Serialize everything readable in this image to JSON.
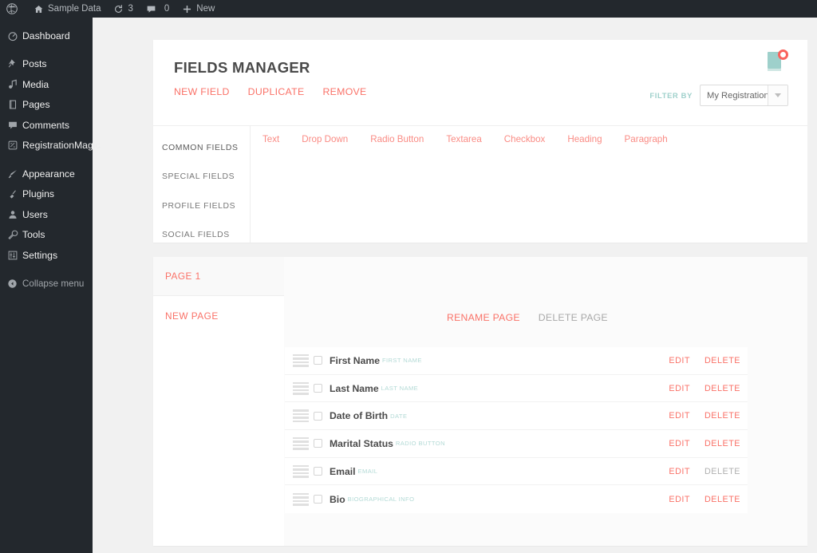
{
  "adminbar": {
    "logo_icon": "wordpress-logo-icon",
    "site_icon": "home-icon",
    "site_name": "Sample Data",
    "updates_icon": "updates-icon",
    "updates_count": "3",
    "comments_icon": "comment-bubble-icon",
    "comments_count": "0",
    "new_icon": "plus-icon",
    "new_label": "New"
  },
  "sidebar": {
    "items": [
      {
        "label": "Dashboard",
        "icon": "dashboard-icon"
      },
      {
        "label": "Posts",
        "icon": "pin-icon"
      },
      {
        "label": "Media",
        "icon": "media-icon"
      },
      {
        "label": "Pages",
        "icon": "pages-icon"
      },
      {
        "label": "Comments",
        "icon": "comment-bubble-icon"
      },
      {
        "label": "RegistrationMagic",
        "icon": "registrationmagic-icon"
      },
      {
        "label": "Appearance",
        "icon": "paintbrush-icon"
      },
      {
        "label": "Plugins",
        "icon": "plug-icon"
      },
      {
        "label": "Users",
        "icon": "user-icon"
      },
      {
        "label": "Tools",
        "icon": "wrench-icon"
      },
      {
        "label": "Settings",
        "icon": "sliders-icon"
      }
    ],
    "collapse_label": "Collapse menu",
    "collapse_icon": "collapse-arrow-icon"
  },
  "fields_manager": {
    "title": "FIELDS MANAGER",
    "actions": [
      {
        "label": "NEW FIELD",
        "state": "active"
      },
      {
        "label": "DUPLICATE",
        "state": "active"
      },
      {
        "label": "REMOVE",
        "state": "active"
      }
    ],
    "sticky_icon": "sticky-note-badge-icon",
    "filter": {
      "label": "FILTER BY",
      "value": "My Registration F...",
      "caret_icon": "chevron-down-icon"
    },
    "categories": [
      {
        "label": "COMMON FIELDS",
        "active": true
      },
      {
        "label": "SPECIAL FIELDS",
        "active": false
      },
      {
        "label": "PROFILE FIELDS",
        "active": false
      },
      {
        "label": "SOCIAL FIELDS",
        "active": false
      }
    ],
    "field_types": [
      "Text",
      "Drop Down",
      "Radio Button",
      "Textarea",
      "Checkbox",
      "Heading",
      "Paragraph"
    ]
  },
  "pages_panel": {
    "tabs": [
      {
        "label": "PAGE 1",
        "active": true
      },
      {
        "label": "NEW PAGE",
        "active": false
      }
    ],
    "page_actions": [
      {
        "label": "RENAME PAGE",
        "state": "active"
      },
      {
        "label": "DELETE PAGE",
        "state": "disabled"
      }
    ],
    "fields": [
      {
        "name": "First Name",
        "type": "FIRST NAME",
        "edit": "EDIT",
        "delete": "DELETE",
        "delete_state": "active"
      },
      {
        "name": "Last Name",
        "type": "LAST NAME",
        "edit": "EDIT",
        "delete": "DELETE",
        "delete_state": "active"
      },
      {
        "name": "Date of Birth",
        "type": "DATE",
        "edit": "EDIT",
        "delete": "DELETE",
        "delete_state": "active"
      },
      {
        "name": "Marital Status",
        "type": "RADIO BUTTON",
        "edit": "EDIT",
        "delete": "DELETE",
        "delete_state": "active"
      },
      {
        "name": "Email",
        "type": "EMAIL",
        "edit": "EDIT",
        "delete": "DELETE",
        "delete_state": "disabled"
      },
      {
        "name": "Bio",
        "type": "BIOGRAPHICAL INFO",
        "edit": "EDIT",
        "delete": "DELETE",
        "delete_state": "active"
      }
    ]
  },
  "colors": {
    "coral": "#fa7268",
    "coral_light": "#fa8b84",
    "teal": "#9ed0cb",
    "teal_light": "#b3dad6",
    "admin_dark": "#23282d",
    "page_bg": "#f1f1f1"
  }
}
